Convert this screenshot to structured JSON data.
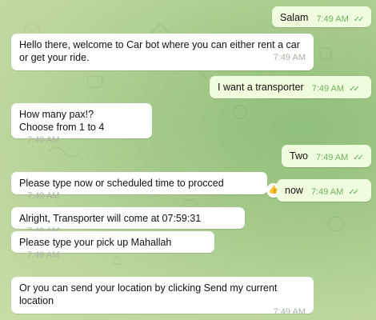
{
  "messages": [
    {
      "text": "Salam",
      "time": "7:49 AM"
    },
    {
      "text": "Hello there, welcome to Car bot where you can either rent a car or get your ride.",
      "time": "7:49 AM"
    },
    {
      "text": "I want a transporter",
      "time": "7:49 AM"
    },
    {
      "text": "How many pax!?\nChoose from 1 to 4",
      "time": "7:49 AM"
    },
    {
      "text": "Two",
      "time": "7:49 AM"
    },
    {
      "text": "Please type now or scheduled time to procced",
      "time": "7:49 AM",
      "reaction": "👍"
    },
    {
      "text": "now",
      "time": "7:49 AM"
    },
    {
      "text": "Alright, Transporter will come at 07:59:31",
      "time": "7:49 AM"
    },
    {
      "text": "Please type your pick up Mahallah",
      "time": "7:49 AM"
    },
    {
      "text": "Or you can send your location by clicking Send my current location",
      "time": "7:49 AM"
    }
  ],
  "read_receipt": "✓✓",
  "colors": {
    "background": "#a4c98a",
    "incoming_bubble": "#ffffff",
    "outgoing_bubble": "#effdde",
    "outgoing_meta": "#70b05e"
  }
}
